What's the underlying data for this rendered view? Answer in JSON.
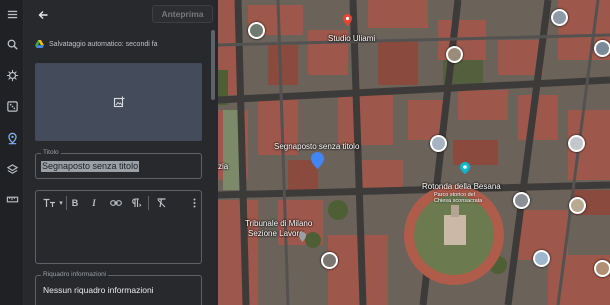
{
  "rail": {
    "icons": [
      "menu-icon",
      "search-icon",
      "voyager-icon",
      "feeling-lucky-icon",
      "projects-icon",
      "layers-icon",
      "measure-icon"
    ]
  },
  "topbar": {
    "preview_label": "Anteprima"
  },
  "autosave": {
    "text": "Salvataggio automatico: secondi fa"
  },
  "title_field": {
    "label": "Titolo",
    "value": "Segnaposto senza titolo"
  },
  "editor_toolbar": {
    "items": [
      "text-size-icon",
      "bold-icon",
      "italic-icon",
      "link-icon",
      "paragraph-icon",
      "clear-format-icon",
      "more-icon"
    ],
    "bold_label": "B",
    "italic_label": "I"
  },
  "info_field": {
    "label": "Riquadro informazioni",
    "value": "Nessun riquadro informazioni"
  },
  "map": {
    "labels": {
      "studio": "Studio Uliami",
      "placemark": "Segnaposto senza titolo",
      "rotonda": "Rotonda della Besana",
      "rotonda_sub1": "Parco storico del",
      "rotonda_sub2": "Chiesa sconsacrata",
      "tribunale_1": "Tribunale di Milano",
      "tribunale_2": "Sezione Lavoro",
      "left_cut": "zia"
    },
    "colors": {
      "roof": "#a4574a",
      "placemark": "#4285f4"
    }
  }
}
